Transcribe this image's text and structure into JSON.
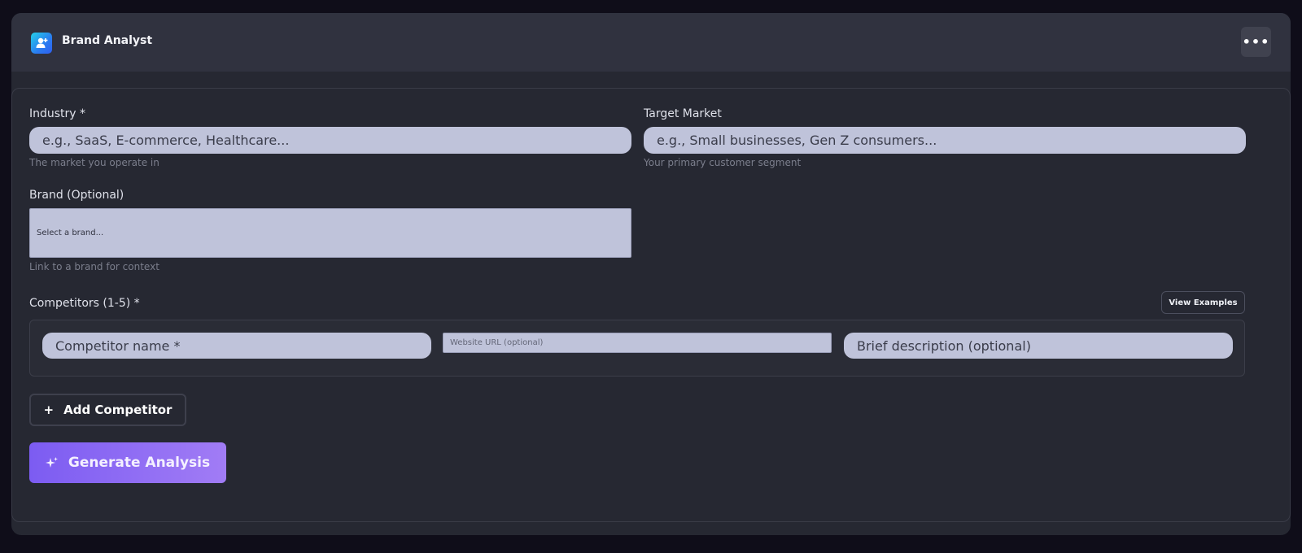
{
  "app": {
    "title": "Brand Analyst",
    "menu_glyph": "•••"
  },
  "form": {
    "industry": {
      "label": "Industry *",
      "placeholder": "e.g., SaaS, E-commerce, Healthcare...",
      "hint": "The market you operate in"
    },
    "target_market": {
      "label": "Target Market",
      "placeholder": "e.g., Small businesses, Gen Z consumers...",
      "hint": "Your primary customer segment"
    },
    "brand": {
      "label": "Brand (Optional)",
      "selected": "Select a brand...",
      "hint": "Link to a brand for context"
    },
    "competitors": {
      "label": "Competitors (1-5) *",
      "view_examples": "View Examples",
      "name_placeholder": "Competitor name *",
      "url_placeholder": "Website URL (optional)",
      "description_placeholder": "Brief description (optional)"
    },
    "add_competitor": {
      "icon": "+",
      "label": "Add Competitor"
    },
    "generate": {
      "label": "Generate Analysis"
    }
  },
  "colors": {
    "background": "#0f0d19",
    "panel": "#262832",
    "header": "#30323f",
    "input": "#bfc3da",
    "accent_start": "#7c5cf2",
    "accent_end": "#a17cf5"
  }
}
